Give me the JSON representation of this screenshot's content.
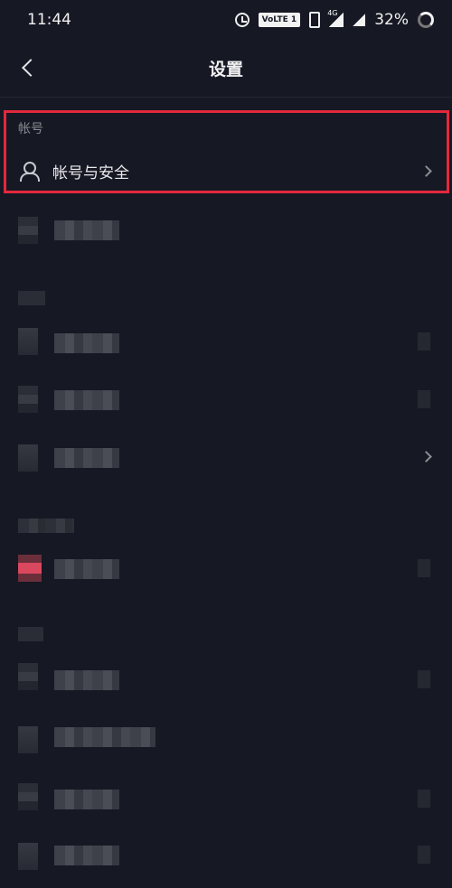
{
  "status_bar": {
    "time": "11:44",
    "volte": "VoLTE 1",
    "network": "4G",
    "battery": "32%"
  },
  "header": {
    "title": "设置"
  },
  "account_section": {
    "label": "帐号",
    "item_label": "帐号与安全"
  },
  "colors": {
    "background": "#161823",
    "highlight": "#e4283c"
  }
}
